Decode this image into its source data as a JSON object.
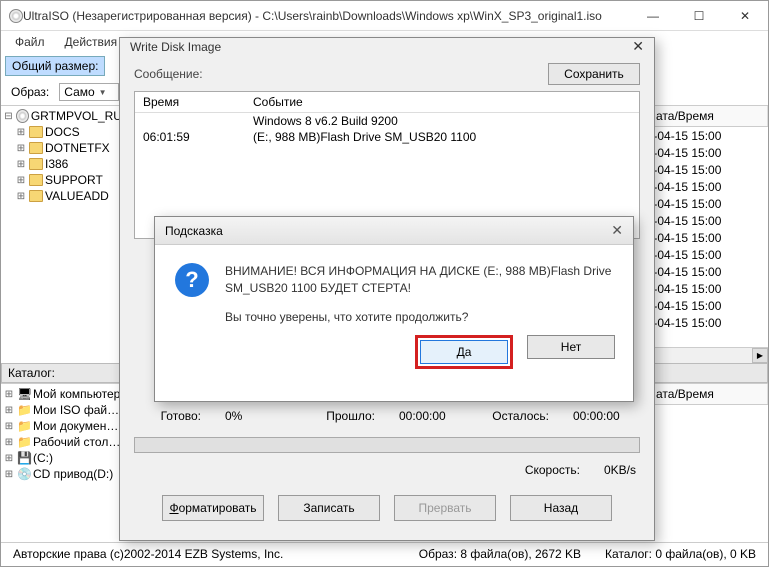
{
  "window": {
    "title": "UltraISO (Незарегистрированная версия) - C:\\Users\\rainb\\Downloads\\Windows xp\\WinX_SP3_original1.iso"
  },
  "menu": {
    "file": "Файл",
    "actions": "Действия"
  },
  "toolbar": {
    "size_label": "Общий размер:",
    "image_label": "Образ:",
    "combo_value": "Само"
  },
  "tree": {
    "root": "GRTMPVOL_RU",
    "nodes": [
      "DOCS",
      "DOTNETFX",
      "I386",
      "SUPPORT",
      "VALUEADD"
    ]
  },
  "list": {
    "col_date": "ата/Время",
    "date_value": "08-04-15 15:00",
    "rows": 12
  },
  "catalog": {
    "label": "Каталог:",
    "items": [
      "Мой компьютер",
      "Мои ISO фай…",
      "Мои докумен…",
      "Рабочий стол…",
      "(C:)",
      "CD привод(D:)"
    ]
  },
  "wdi": {
    "title": "Write Disk Image",
    "message_label": "Сообщение:",
    "save": "Сохранить",
    "log_head_time": "Время",
    "log_head_event": "Событие",
    "log_row1_event": "Windows 8 v6.2 Build 9200",
    "log_row2_time": "06:01:59",
    "log_row2_event": "(E:, 988 MB)Flash  Drive SM_USB20  1100",
    "ready": "Готово:",
    "ready_pct": "0%",
    "elapsed": "Прошло:",
    "elapsed_v": "00:00:00",
    "remain": "Осталось:",
    "remain_v": "00:00:00",
    "speed": "Скорость:",
    "speed_v": "0KB/s",
    "btn_format": "Форматировать",
    "btn_write": "Записать",
    "btn_abort": "Прервать",
    "btn_back": "Назад"
  },
  "confirm": {
    "title": "Подсказка",
    "line1": "ВНИМАНИЕ! ВСЯ ИНФОРМАЦИЯ НА ДИСКЕ (E:, 988 MB)Flash  Drive SM_USB20  1100 БУДЕТ СТЕРТА!",
    "line2": "Вы точно уверены, что хотите продолжить?",
    "yes": "Да",
    "no": "Нет"
  },
  "status": {
    "copyright": "Авторские права (c)2002-2014 EZB Systems, Inc.",
    "image": "Образ: 8 файла(ов), 2672 KB",
    "catalog": "Каталог: 0 файла(ов), 0 KB"
  }
}
